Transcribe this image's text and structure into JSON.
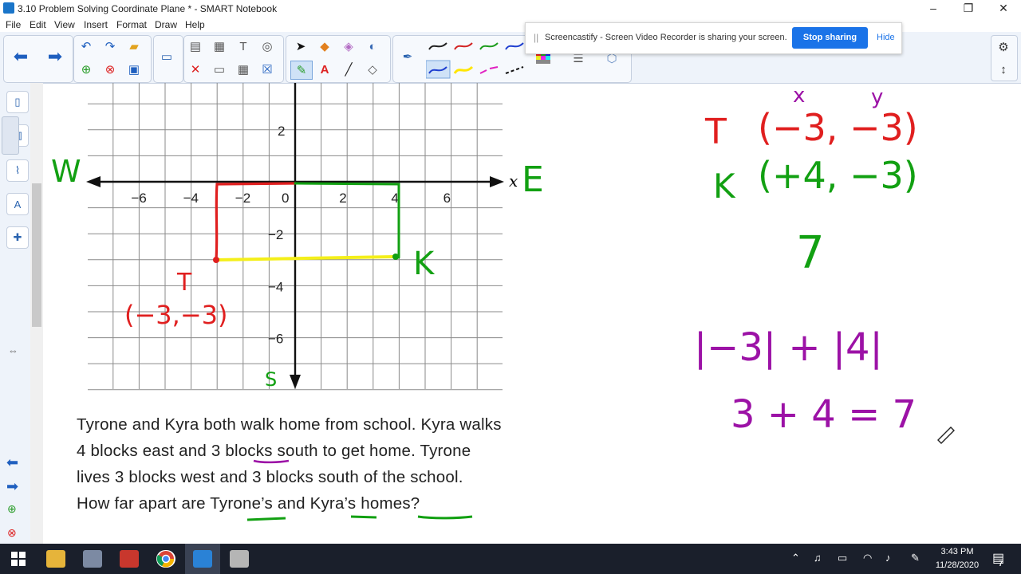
{
  "window": {
    "title": "3.10 Problem Solving Coordinate Plane * - SMART Notebook",
    "minimize": "–",
    "restore": "❐",
    "close": "✕"
  },
  "menu": [
    "File",
    "Edit",
    "View",
    "Insert",
    "Format",
    "Draw",
    "Help"
  ],
  "share_banner": {
    "grip": "||",
    "text": "Screencastify - Screen Video Recorder is sharing your screen.",
    "stop_label": "Stop sharing",
    "hide_label": "Hide"
  },
  "toolbar": {
    "icons": [
      "back-arrow-icon",
      "forward-arrow-icon",
      "undo-icon",
      "redo-icon",
      "open-folder-icon",
      "add-page-icon",
      "delete-page-icon",
      "save-icon",
      "display-icon",
      "paste-icon",
      "screenshade-icon",
      "text-icon",
      "table-icon",
      "close-icon",
      "select-icon",
      "fill-icon",
      "eraser-icon",
      "magic-pen-icon",
      "pen-icon",
      "text-tool-icon",
      "line-icon",
      "eraser-tool-icon",
      "color-palette-icon",
      "properties-icon",
      "gear-icon",
      "resize-icon"
    ],
    "pen_colors": [
      "#222222",
      "#d22222",
      "#1c9c1c",
      "#1f3fd0",
      "#ffe600",
      "#e020c0",
      "#111111"
    ]
  },
  "colors": {
    "red": "#e01f1f",
    "green": "#12a012",
    "yellow": "#f4ef1a",
    "purple": "#9c12a6",
    "axis": "#111111",
    "grid": "#8a8a8a"
  },
  "graph": {
    "x_axis_label": "x",
    "x_ticks": [
      "−6",
      "−4",
      "−2",
      "0",
      "2",
      "4",
      "6"
    ],
    "y_ticks": [
      "2",
      "−2",
      "−4",
      "−6"
    ]
  },
  "annotations": {
    "west": "W",
    "east": "E",
    "south": "S",
    "t_label": "T",
    "k_label": "K",
    "t_coords": "(−3,−3)",
    "right_x": "x",
    "right_y": "y",
    "right_t": "T",
    "right_t_coords": "(−3, −3)",
    "right_k": "K",
    "right_k_coords": "(+4, −3)",
    "answer_seven": "7",
    "abs_expr": "|−3| + |4|",
    "sum_expr": "3 + 4 = 7"
  },
  "problem": {
    "line1": "Tyrone and Kyra both walk home from school. Kyra walks",
    "line2_a": "4 blocks east and 3 ",
    "line2_b": "bloc",
    "line2_c": "ks south to get home. Tyrone",
    "line3": "lives 3 blocks west and 3 blocks south of the school.",
    "line4": "How far apart are Tyrone’s and Kyra’s homes?"
  },
  "taskbar": {
    "time": "3:43 PM",
    "date": "11/28/2020",
    "notification_count": "7"
  }
}
